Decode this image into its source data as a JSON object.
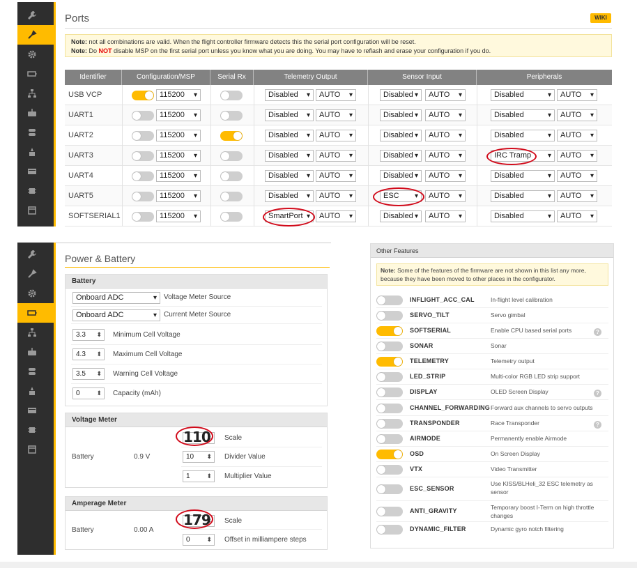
{
  "ports": {
    "title": "Ports",
    "wiki_label": "WIKI",
    "note_line1_bold": "Note:",
    "note_line1": " not all combinations are valid. When the flight controller firmware detects this the serial port configuration will be reset.",
    "note_line2_bold": "Note:",
    "note_line2_pre": " Do ",
    "note_line2_not": "NOT",
    "note_line2_post": " disable MSP on the first serial port unless you know what you are doing. You may have to reflash and erase your configuration if you do.",
    "headers": [
      "Identifier",
      "Configuration/MSP",
      "Serial Rx",
      "Telemetry Output",
      "Sensor Input",
      "Peripherals"
    ],
    "rows": [
      {
        "id": "USB VCP",
        "msp": true,
        "msp_baud": "115200",
        "rx": false,
        "telemetry": "Disabled",
        "telemetry_baud": "AUTO",
        "sensor": "Disabled",
        "sensor_baud": "AUTO",
        "peripheral": "Disabled",
        "peripheral_baud": "AUTO"
      },
      {
        "id": "UART1",
        "msp": false,
        "msp_baud": "115200",
        "rx": false,
        "telemetry": "Disabled",
        "telemetry_baud": "AUTO",
        "sensor": "Disabled",
        "sensor_baud": "AUTO",
        "peripheral": "Disabled",
        "peripheral_baud": "AUTO"
      },
      {
        "id": "UART2",
        "msp": false,
        "msp_baud": "115200",
        "rx": true,
        "telemetry": "Disabled",
        "telemetry_baud": "AUTO",
        "sensor": "Disabled",
        "sensor_baud": "AUTO",
        "peripheral": "Disabled",
        "peripheral_baud": "AUTO"
      },
      {
        "id": "UART3",
        "msp": false,
        "msp_baud": "115200",
        "rx": false,
        "telemetry": "Disabled",
        "telemetry_baud": "AUTO",
        "sensor": "Disabled",
        "sensor_baud": "AUTO",
        "peripheral": "IRC Tramp",
        "peripheral_baud": "AUTO"
      },
      {
        "id": "UART4",
        "msp": false,
        "msp_baud": "115200",
        "rx": false,
        "telemetry": "Disabled",
        "telemetry_baud": "AUTO",
        "sensor": "Disabled",
        "sensor_baud": "AUTO",
        "peripheral": "Disabled",
        "peripheral_baud": "AUTO"
      },
      {
        "id": "UART5",
        "msp": false,
        "msp_baud": "115200",
        "rx": false,
        "telemetry": "Disabled",
        "telemetry_baud": "AUTO",
        "sensor": "ESC",
        "sensor_baud": "AUTO",
        "peripheral": "Disabled",
        "peripheral_baud": "AUTO"
      },
      {
        "id": "SOFTSERIAL1",
        "msp": false,
        "msp_baud": "115200",
        "rx": false,
        "telemetry": "SmartPort",
        "telemetry_baud": "AUTO",
        "sensor": "Disabled",
        "sensor_baud": "AUTO",
        "peripheral": "Disabled",
        "peripheral_baud": "AUTO"
      }
    ]
  },
  "power": {
    "title": "Power & Battery",
    "battery": {
      "header": "Battery",
      "voltage_source": "Onboard ADC",
      "voltage_source_label": "Voltage Meter Source",
      "current_source": "Onboard ADC",
      "current_source_label": "Current Meter Source",
      "min_cell": "3.3",
      "min_cell_label": "Minimum Cell Voltage",
      "max_cell": "4.3",
      "max_cell_label": "Maximum Cell Voltage",
      "warn_cell": "3.5",
      "warn_cell_label": "Warning Cell Voltage",
      "capacity": "0",
      "capacity_label": "Capacity (mAh)"
    },
    "voltage_meter": {
      "header": "Voltage Meter",
      "name": "Battery",
      "value": "0.9 V",
      "scale": "110",
      "scale_label": "Scale",
      "divider": "10",
      "divider_label": "Divider Value",
      "multiplier": "1",
      "multiplier_label": "Multiplier Value"
    },
    "amperage_meter": {
      "header": "Amperage Meter",
      "name": "Battery",
      "value": "0.00 A",
      "scale": "179",
      "scale_label": "Scale",
      "offset": "0",
      "offset_label": "Offset in milliampere steps"
    }
  },
  "other": {
    "header": "Other Features",
    "note_bold": "Note:",
    "note_text": " Some of the features of the firmware are not shown in this list any more, because they have been moved to other places in the configurator.",
    "features": [
      {
        "name": "INFLIGHT_ACC_CAL",
        "desc": "In-flight level calibration",
        "on": false,
        "help": false
      },
      {
        "name": "SERVO_TILT",
        "desc": "Servo gimbal",
        "on": false,
        "help": false
      },
      {
        "name": "SOFTSERIAL",
        "desc": "Enable CPU based serial ports",
        "on": true,
        "help": true
      },
      {
        "name": "SONAR",
        "desc": "Sonar",
        "on": false,
        "help": false
      },
      {
        "name": "TELEMETRY",
        "desc": "Telemetry output",
        "on": true,
        "help": false
      },
      {
        "name": "LED_STRIP",
        "desc": "Multi-color RGB LED strip support",
        "on": false,
        "help": false
      },
      {
        "name": "DISPLAY",
        "desc": "OLED Screen Display",
        "on": false,
        "help": true
      },
      {
        "name": "CHANNEL_FORWARDING",
        "desc": "Forward aux channels to servo outputs",
        "on": false,
        "help": false
      },
      {
        "name": "TRANSPONDER",
        "desc": "Race Transponder",
        "on": false,
        "help": true
      },
      {
        "name": "AIRMODE",
        "desc": "Permanently enable Airmode",
        "on": false,
        "help": false
      },
      {
        "name": "OSD",
        "desc": "On Screen Display",
        "on": true,
        "help": false
      },
      {
        "name": "VTX",
        "desc": "Video Transmitter",
        "on": false,
        "help": false
      },
      {
        "name": "ESC_SENSOR",
        "desc": "Use KISS/BLHeli_32 ESC telemetry as sensor",
        "on": false,
        "help": false
      },
      {
        "name": "ANTI_GRAVITY",
        "desc": "Temporary boost I-Term on high throttle changes",
        "on": false,
        "help": false
      },
      {
        "name": "DYNAMIC_FILTER",
        "desc": "Dynamic gyro notch filtering",
        "on": false,
        "help": false
      }
    ]
  },
  "icons": [
    "wrench-icon",
    "calibrate-icon",
    "gear-icon",
    "battery-icon",
    "network-icon",
    "motors-icon",
    "servos-icon",
    "led-icon",
    "osd-icon",
    "chip-icon",
    "log-icon"
  ],
  "colors": {
    "accent": "#ffbb00",
    "sidebar": "#2e2e2e",
    "header": "#828282",
    "circle": "#d10a1a"
  }
}
